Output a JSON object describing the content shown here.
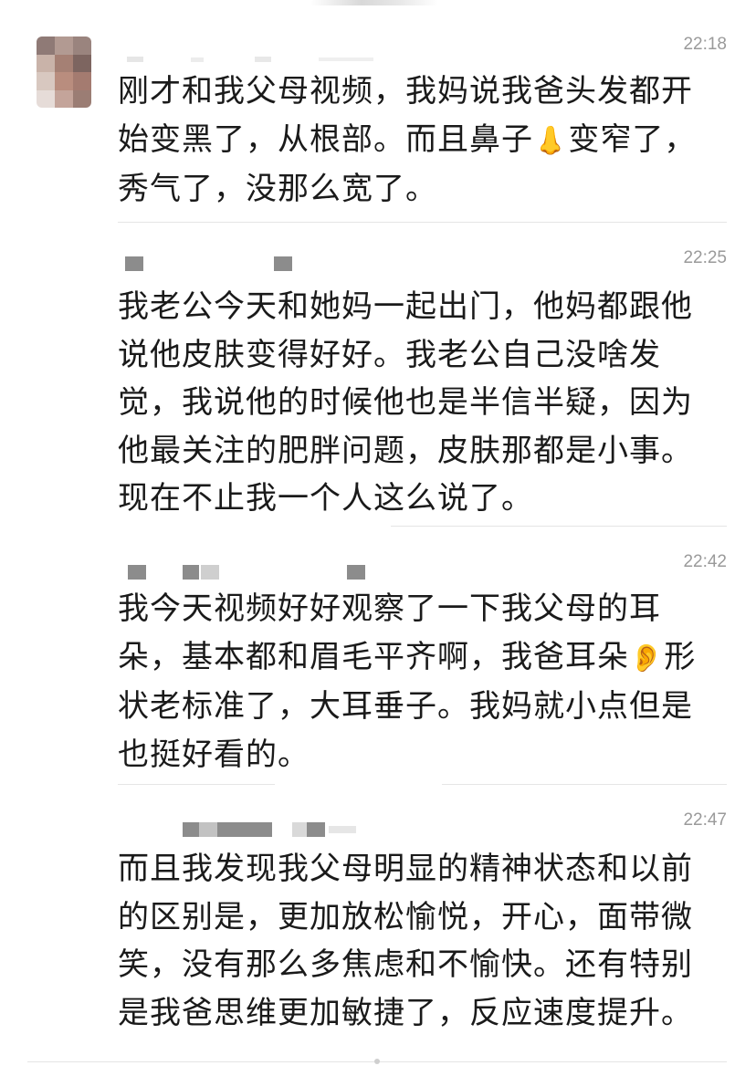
{
  "messages": [
    {
      "time": "22:18",
      "text": "刚才和我父母视频，我妈说我爸头发都开始变黑了，从根部。而且鼻子👃变窄了，秀气了，没那么宽了。"
    },
    {
      "time": "22:25",
      "text": "我老公今天和她妈一起出门，他妈都跟他说他皮肤变得好好。我老公自己没啥发觉，我说他的时候他也是半信半疑，因为他最关注的肥胖问题，皮肤那都是小事。现在不止我一个人这么说了。"
    },
    {
      "time": "22:42",
      "text": "我今天视频好好观察了一下我父母的耳朵，基本都和眉毛平齐啊，我爸耳朵👂形状老标准了，大耳垂子。我妈就小点但是也挺好看的。"
    },
    {
      "time": "22:47",
      "text": "而且我发现我父母明显的精神状态和以前的区别是，更加放松愉悦，开心，面带微笑，没有那么多焦虑和不愉快。还有特别是我爸思维更加敏捷了，反应速度提升。"
    }
  ],
  "colors": {
    "text": "#1a1a1a",
    "time": "#9a9a9a",
    "divider": "#e5e5e5",
    "blur": "#8c8c8c"
  },
  "icons": {
    "nose": "nose-emoji",
    "ear": "ear-emoji"
  }
}
